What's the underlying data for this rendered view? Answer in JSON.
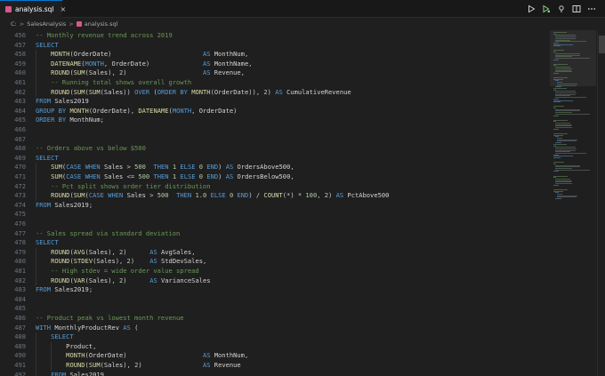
{
  "tab": {
    "filename": "analysis.sql",
    "close_glyph": "×",
    "icon": "sql-file-icon"
  },
  "breadcrumb": {
    "folder": "C:",
    "sep": ">",
    "project": "SalesAnalysis",
    "file": "analysis.sql"
  },
  "actions": [
    {
      "name": "run-icon"
    },
    {
      "name": "run-debug-icon"
    },
    {
      "name": "pin-icon"
    },
    {
      "name": "split-editor-icon"
    },
    {
      "name": "more-actions-icon"
    }
  ],
  "colors": {
    "keyword": "#569cd6",
    "function": "#dcdcaa",
    "string": "#ce9178",
    "number": "#b5cea8",
    "comment": "#6a9955",
    "accent": "#0078d4"
  },
  "lines": [
    {
      "n": "456",
      "t": "-- Monthly revenue trend across 2019"
    },
    {
      "n": "457",
      "t": "SELECT"
    },
    {
      "n": "458",
      "t": "    MONTH(OrderDate)                        AS MonthNum,"
    },
    {
      "n": "459",
      "t": "    DATENAME(MONTH, OrderDate)              AS MonthName,"
    },
    {
      "n": "460",
      "t": "    ROUND(SUM(Sales), 2)                    AS Revenue,"
    },
    {
      "n": "461",
      "t": "    -- Running total shows overall growth"
    },
    {
      "n": "462",
      "t": "    ROUND(SUM(SUM(Sales)) OVER (ORDER BY MONTH(OrderDate)), 2) AS CumulativeRevenue"
    },
    {
      "n": "463",
      "t": "FROM Sales2019"
    },
    {
      "n": "464",
      "t": "GROUP BY MONTH(OrderDate), DATENAME(MONTH, OrderDate)"
    },
    {
      "n": "465",
      "t": "ORDER BY MonthNum;"
    },
    {
      "n": "466",
      "t": ""
    },
    {
      "n": "467",
      "t": ""
    },
    {
      "n": "468",
      "t": "-- Orders above vs below $500"
    },
    {
      "n": "469",
      "t": "SELECT"
    },
    {
      "n": "470",
      "t": "    SUM(CASE WHEN Sales > 500  THEN 1 ELSE 0 END) AS OrdersAbove500,"
    },
    {
      "n": "471",
      "t": "    SUM(CASE WHEN Sales <= 500 THEN 1 ELSE 0 END) AS OrdersBelow500,"
    },
    {
      "n": "472",
      "t": "    -- Pct split shows order tier distribution"
    },
    {
      "n": "473",
      "t": "    ROUND(SUM(CASE WHEN Sales > 500  THEN 1.0 ELSE 0 END) / COUNT(*) * 100, 2) AS PctAbove500"
    },
    {
      "n": "474",
      "t": "FROM Sales2019;"
    },
    {
      "n": "475",
      "t": ""
    },
    {
      "n": "476",
      "t": ""
    },
    {
      "n": "477",
      "t": "-- Sales spread via standard deviation"
    },
    {
      "n": "478",
      "t": "SELECT"
    },
    {
      "n": "479",
      "t": "    ROUND(AVG(Sales), 2)      AS AvgSales,"
    },
    {
      "n": "480",
      "t": "    ROUND(STDEV(Sales), 2)    AS StdDevSales,"
    },
    {
      "n": "481",
      "t": "    -- High stdev = wide order value spread"
    },
    {
      "n": "482",
      "t": "    ROUND(VAR(Sales), 2)      AS VarianceSales"
    },
    {
      "n": "483",
      "t": "FROM Sales2019;"
    },
    {
      "n": "484",
      "t": ""
    },
    {
      "n": "485",
      "t": ""
    },
    {
      "n": "486",
      "t": "-- Product peak vs lowest month revenue"
    },
    {
      "n": "487",
      "t": "WITH MonthlyProductRev AS ("
    },
    {
      "n": "488",
      "t": "    SELECT"
    },
    {
      "n": "489",
      "t": "        Product,"
    },
    {
      "n": "490",
      "t": "        MONTH(OrderDate)                    AS MonthNum,"
    },
    {
      "n": "491",
      "t": "        ROUND(SUM(Sales), 2)                AS Revenue"
    },
    {
      "n": "492",
      "t": "    FROM Sales2019"
    }
  ]
}
